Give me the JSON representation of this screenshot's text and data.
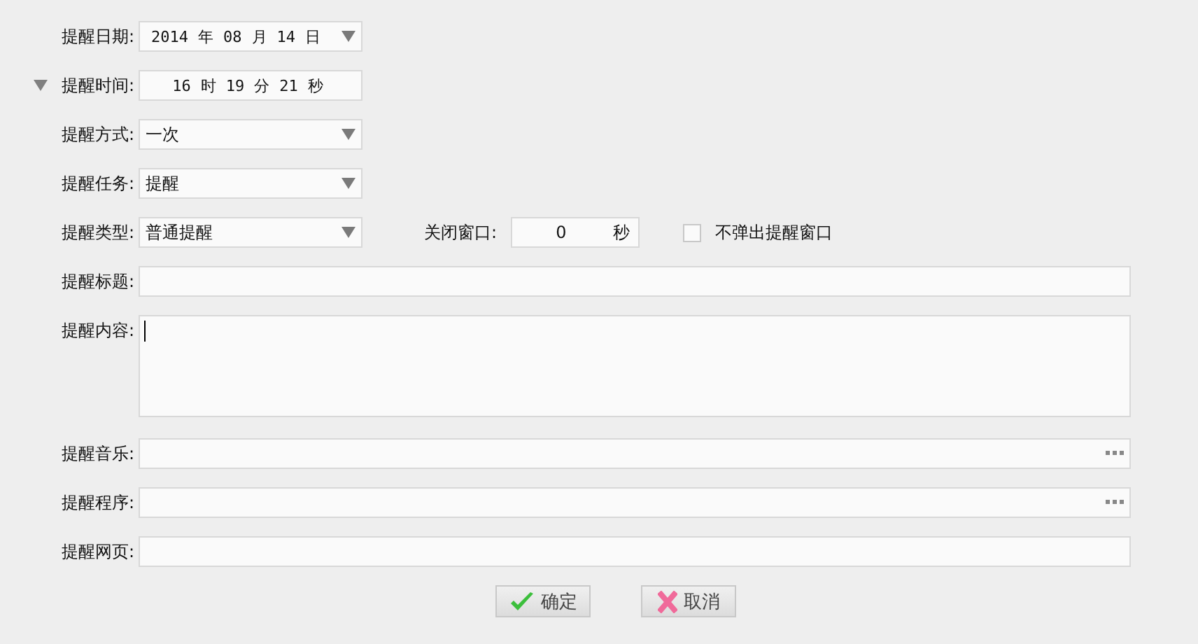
{
  "rows": [
    {
      "kind": "date",
      "label": "提醒日期:",
      "parts": [
        "2014",
        "年",
        "08",
        "月",
        "14",
        "日"
      ]
    },
    {
      "kind": "time",
      "label": "提醒时间:",
      "expanded": true,
      "parts": [
        "16",
        "时",
        "19",
        "分",
        "21",
        "秒"
      ]
    },
    {
      "kind": "select",
      "label": "提醒方式:",
      "value": "一次"
    },
    {
      "kind": "select",
      "label": "提醒任务:",
      "value": "提醒"
    },
    {
      "kind": "select",
      "label": "提醒类型:",
      "value": "普通提醒",
      "close_label": "关闭窗口:",
      "close_value": "0",
      "close_unit": "秒",
      "checkbox": {
        "label": "不弹出提醒窗口",
        "checked": false
      }
    },
    {
      "kind": "text",
      "label": "提醒标题:"
    },
    {
      "kind": "textarea",
      "label": "提醒内容:",
      "focused": true
    },
    {
      "kind": "file",
      "label": "提醒音乐:"
    },
    {
      "kind": "file",
      "label": "提醒程序:"
    },
    {
      "kind": "text",
      "label": "提醒网页:"
    }
  ],
  "buttons": [
    {
      "kind": "ok",
      "label": "确定"
    },
    {
      "kind": "cancel",
      "label": "取消"
    }
  ]
}
